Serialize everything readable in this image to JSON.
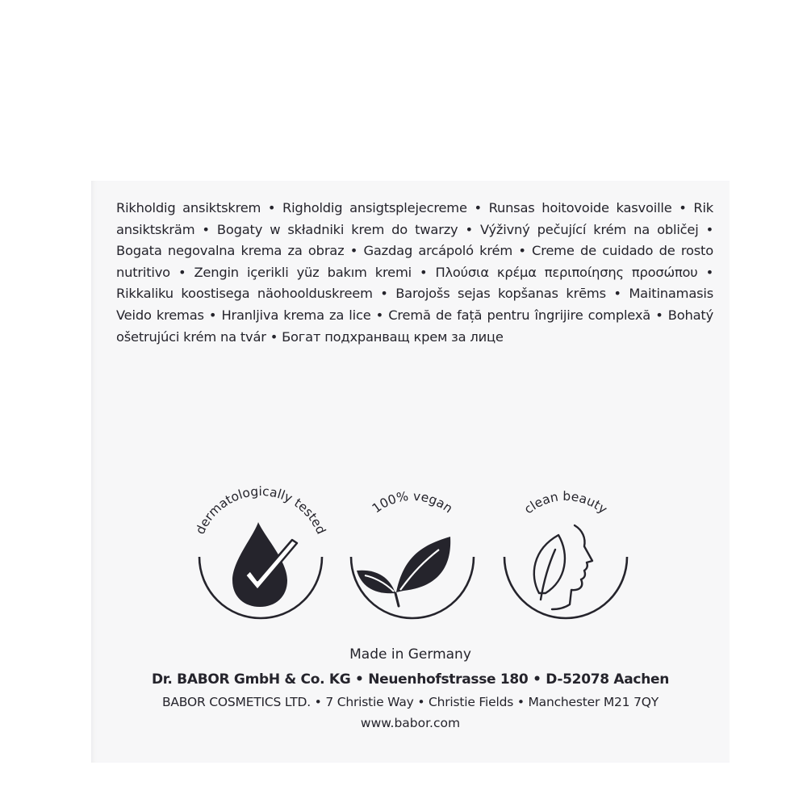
{
  "description": "Rikholdig ansiktskrem • Righoldig ansigtsplejecreme • Runsas hoitovoide kasvoille • Rik ansiktskräm • Bogaty w składniki krem do twarzy • Výživný pečující krém na obličej • Bogata negovalna krema za obraz • Gazdag arcápoló krém • Creme de cuidado de rosto nutritivo • Zengin içerikli yüz bakım kremi • Πλούσια κρέμα περιποίησης προσώπου • Rikkaliku koostisega näohoolduskreem • Barojošs sejas kopšanas krēms • Maitinamasis Veido kremas • Hranljiva krema za lice • Cremă de față pentru îngrijire complexă • Bohatý ošetrujúci krém na tvár • Богат подхранващ крем за лице",
  "badges": [
    {
      "label": "dermatologically tested",
      "icon": "drop-checkmark-icon"
    },
    {
      "label": "100% vegan",
      "icon": "leaves-icon"
    },
    {
      "label": "clean beauty",
      "icon": "face-leaf-icon"
    }
  ],
  "footer": {
    "made_in": "Made in Germany",
    "company": "Dr. BABOR GmbH & Co. KG • Neuenhofstrasse 180 • D-52078 Aachen",
    "uk_address": "BABOR COSMETICS LTD. • 7 Christie Way • Christie Fields • Manchester M21 7QY",
    "website": "www.babor.com"
  },
  "colors": {
    "ink": "#25242c",
    "box": "#f7f7f8",
    "background": "#ffffff"
  }
}
